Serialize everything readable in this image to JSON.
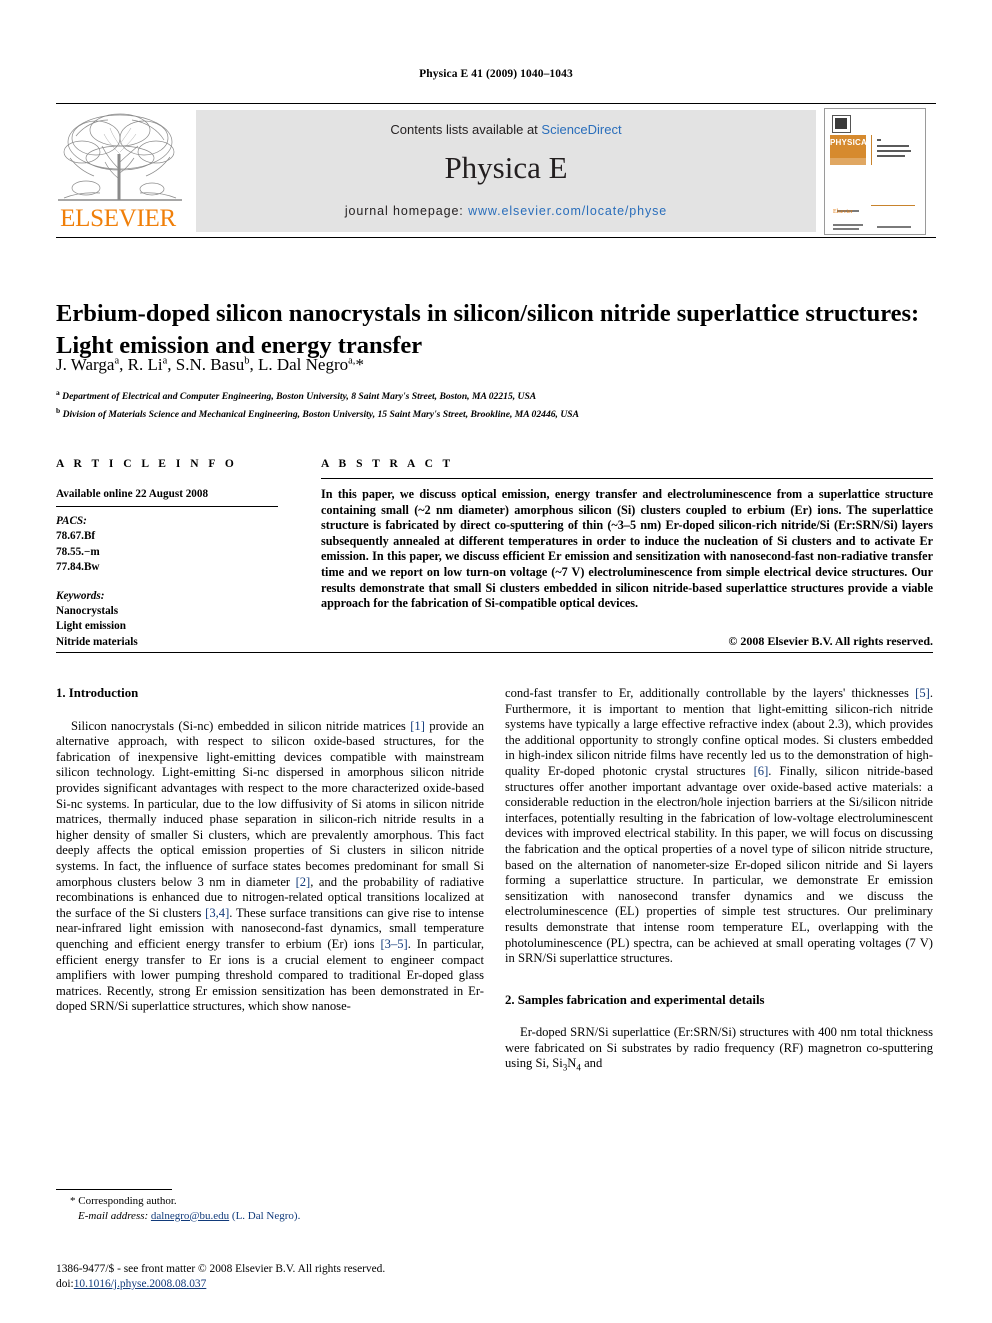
{
  "running_head": "Physica E 41 (2009) 1040–1043",
  "masthead": {
    "contents_prefix": "Contents lists available at ",
    "contents_link": "ScienceDirect",
    "journal_title": "Physica E",
    "homepage_prefix": "journal homepage: ",
    "homepage_link": "www.elsevier.com/locate/physe",
    "publisher_wordmark": "ELSEVIER",
    "cover_band_label": "PHYSICA",
    "cover_elsevier_label": "Elsevier"
  },
  "article": {
    "title": "Erbium-doped silicon nanocrystals in silicon/silicon nitride superlattice structures: Light emission and energy transfer",
    "authors_html": "J. Warga<sup>a</sup>, R. Li<sup>a</sup>, S.N. Basu<sup>b</sup>, L. Dal Negro<sup>a,</sup>*",
    "affiliations": [
      "Department of Electrical and Computer Engineering, Boston University, 8 Saint Mary's Street, Boston, MA 02215, USA",
      "Division of Materials Science and Mechanical Engineering, Boston University, 15 Saint Mary's Street, Brookline, MA 02446, USA"
    ],
    "affiliation_marks": [
      "a",
      "b"
    ]
  },
  "article_info": {
    "heading": "A R T I C L E  I N F O",
    "available_online": "Available online 22 August 2008",
    "pacs_label": "PACS:",
    "pacs": [
      "78.67.Bf",
      "78.55.−m",
      "77.84.Bw"
    ],
    "keywords_label": "Keywords:",
    "keywords": [
      "Nanocrystals",
      "Light emission",
      "Nitride materials"
    ]
  },
  "abstract": {
    "heading": "A B S T R A C T",
    "text": "In this paper, we discuss optical emission, energy transfer and electroluminescence from a superlattice structure containing small (~2 nm diameter) amorphous silicon (Si) clusters coupled to erbium (Er) ions. The superlattice structure is fabricated by direct co-sputtering of thin (~3–5 nm) Er-doped silicon-rich nitride/Si (Er:SRN/Si) layers subsequently annealed at different temperatures in order to induce the nucleation of Si clusters and to activate Er emission. In this paper, we discuss efficient Er emission and sensitization with nanosecond-fast non-radiative transfer time and we report on low turn-on voltage (~7 V) electroluminescence from simple electrical device structures. Our results demonstrate that small Si clusters embedded in silicon nitride-based superlattice structures provide a viable approach for the fabrication of Si-compatible optical devices.",
    "copyright": "© 2008 Elsevier B.V. All rights reserved."
  },
  "body": {
    "section1_heading": "1. Introduction",
    "section2_heading": "2. Samples fabrication and experimental details",
    "left_paragraph_1": "Silicon nanocrystals (Si-nc) embedded in silicon nitride matrices [1] provide an alternative approach, with respect to silicon oxide-based structures, for the fabrication of inexpensive light-emitting devices compatible with mainstream silicon technology. Light-emitting Si-nc dispersed in amorphous silicon nitride provides significant advantages with respect to the more characterized oxide-based Si-nc systems. In particular, due to the low diffusivity of Si atoms in silicon nitride matrices, thermally induced phase separation in silicon-rich nitride results in a higher density of smaller Si clusters, which are prevalently amorphous. This fact deeply affects the optical emission properties of Si clusters in silicon nitride systems. In fact, the influence of surface states becomes predominant for small Si amorphous clusters below 3 nm in diameter [2], and the probability of radiative recombinations is enhanced due to nitrogen-related optical transitions localized at the surface of the Si clusters [3,4]. These surface transitions can give rise to intense near-infrared light emission with nanosecond-fast dynamics, small temperature quenching and efficient energy transfer to erbium (Er) ions [3–5]. In particular, efficient energy transfer to Er ions is a crucial element to engineer compact amplifiers with lower pumping threshold compared to traditional Er-doped glass matrices. Recently, strong Er emission sensitization has been demonstrated in Er-doped SRN/Si superlattice structures, which show nanose-",
    "right_paragraph_1": "cond-fast transfer to Er, additionally controllable by the layers' thicknesses [5]. Furthermore, it is important to mention that light-emitting silicon-rich nitride systems have typically a large effective refractive index (about 2.3), which provides the additional opportunity to strongly confine optical modes. Si clusters embedded in high-index silicon nitride films have recently led us to the demonstration of high-quality Er-doped photonic crystal structures [6]. Finally, silicon nitride-based structures offer another important advantage over oxide-based active materials: a considerable reduction in the electron/hole injection barriers at the Si/silicon nitride interfaces, potentially resulting in the fabrication of low-voltage electroluminescent devices with improved electrical stability. In this paper, we will focus on discussing the fabrication and the optical properties of a novel type of silicon nitride structure, based on the alternation of nanometer-size Er-doped silicon nitride and Si layers forming a superlattice structure. In particular, we demonstrate Er emission sensitization with nanosecond transfer dynamics and we discuss the electroluminescence (EL) properties of simple test structures. Our preliminary results demonstrate that intense room temperature EL, overlapping with the photoluminescence (PL) spectra, can be achieved at small operating voltages (7 V) in SRN/Si superlattice structures.",
    "right_paragraph_2_html": "Er-doped SRN/Si superlattice (Er:SRN/Si) structures with 400 nm total thickness were fabricated on Si substrates by radio frequency (RF) magnetron co-sputtering using Si, Si<sub>3</sub>N<sub>4</sub> and"
  },
  "footnotes": {
    "corresponding_marker": "*",
    "corresponding_author": "Corresponding author.",
    "email_label": "E-mail address:",
    "email": "dalnegro@bu.edu",
    "email_owner": "(L. Dal Negro)."
  },
  "footer": {
    "issn_line": "1386-9477/$ - see front matter © 2008 Elsevier B.V. All rights reserved.",
    "doi_label": "doi:",
    "doi_value": "10.1016/j.physe.2008.08.037"
  },
  "colors": {
    "link_blue": "#2a6ebb",
    "ref_blue": "#113a7a",
    "elsevier_orange": "#f07f09",
    "masthead_grey": "#e3e3e3",
    "cover_band": "#d68a2e"
  }
}
